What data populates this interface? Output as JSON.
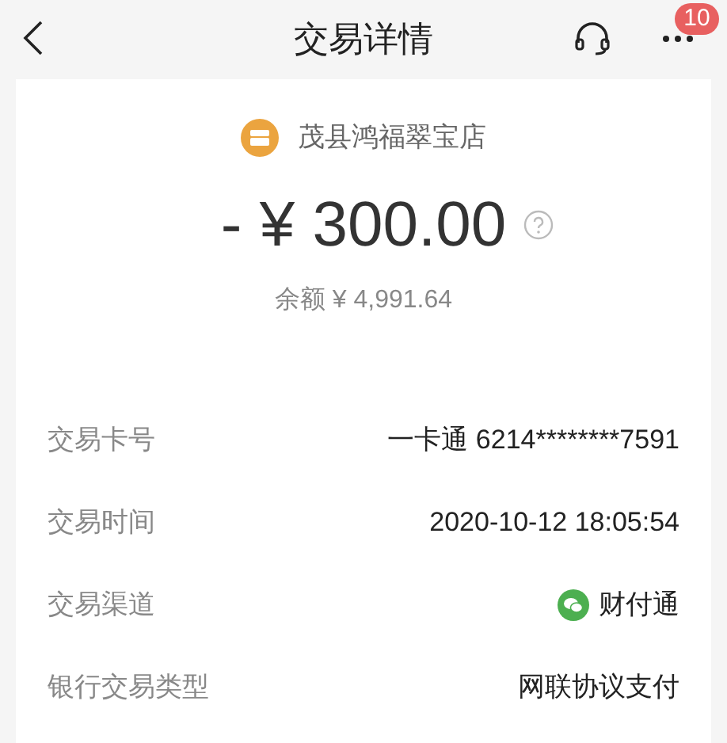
{
  "header": {
    "title": "交易详情",
    "badge": "10"
  },
  "merchant": {
    "name": "茂县鸿福翠宝店"
  },
  "amount": "- ¥ 300.00",
  "balance": "余额 ¥ 4,991.64",
  "details": [
    {
      "kind": "text",
      "label": "交易卡号",
      "value": "一卡通 6214********7591"
    },
    {
      "kind": "text",
      "label": "交易时间",
      "value": "2020-10-12 18:05:54"
    },
    {
      "kind": "channel",
      "label": "交易渠道",
      "value": "财付通"
    },
    {
      "kind": "text",
      "label": "银行交易类型",
      "value": "网联协议支付"
    }
  ]
}
